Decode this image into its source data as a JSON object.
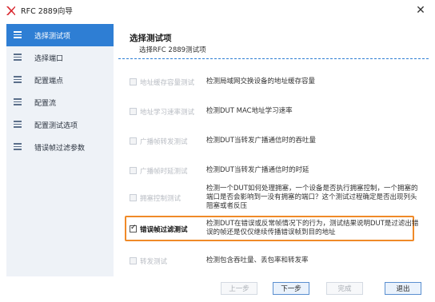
{
  "window": {
    "title": "RFC 2889向导",
    "close_glyph": "✕"
  },
  "sidebar": {
    "items": [
      {
        "label": "选择测试项",
        "active": true
      },
      {
        "label": "选择端口",
        "active": false
      },
      {
        "label": "配置端点",
        "active": false
      },
      {
        "label": "配置流",
        "active": false
      },
      {
        "label": "配置测试选项",
        "active": false
      },
      {
        "label": "错误帧过滤参数",
        "active": false
      }
    ]
  },
  "main": {
    "title": "选择测试项",
    "subtitle": "选择RFC 2889测试项",
    "tests": [
      {
        "name": "地址缓存容量测试",
        "enabled": false,
        "checked": false,
        "desc": "检测局域网交换设备的地址缓存容量"
      },
      {
        "name": "地址学习速率测试",
        "enabled": false,
        "checked": false,
        "desc": "检测DUT MAC地址学习速率"
      },
      {
        "name": "广播帧转发测试",
        "enabled": false,
        "checked": false,
        "desc": "检测DUT当转发广播通信时的吞吐量"
      },
      {
        "name": "广播帧时延测试",
        "enabled": false,
        "checked": false,
        "desc": "检测DUT当转发广播通信时的时延"
      },
      {
        "name": "拥塞控制测试",
        "enabled": false,
        "checked": false,
        "desc": "检测一个DUT如何处理拥塞，一个设备是否执行拥塞控制，一个拥塞的端口是否会影响到一没有拥塞的端口？这个测试过程确定是否出现列头阻塞或者反压"
      },
      {
        "name": "错误帧过滤测试",
        "enabled": true,
        "checked": true,
        "desc": "检测DUT在错误或反常帧情况下的行为，测试结果说明DUT是过滤出错误的帧还是仅仅继续传播错误帧到目的地址"
      },
      {
        "name": "转发测试",
        "enabled": false,
        "checked": false,
        "desc": "检测包含吞吐量、丢包率和转发率"
      }
    ]
  },
  "footer": {
    "prev_label": "上一步",
    "next_label": "下一步",
    "finish_label": "完成",
    "exit_label": "退出"
  },
  "colors": {
    "accent": "#2e7ed4",
    "highlight": "#f08a28",
    "sidebar_bg": "#eef2f7"
  },
  "icons": {
    "app": "app-logo-icon",
    "nav": "hamburger-icon"
  }
}
